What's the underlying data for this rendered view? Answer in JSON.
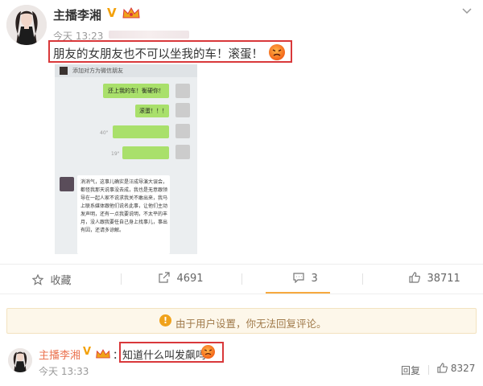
{
  "post": {
    "username": "主播李湘",
    "v_badge": "V",
    "time": "今天 13:23",
    "text": "朋友的女朋友也不可以坐我的车！滚蛋！",
    "emoji_icon": "angry-face-emoji"
  },
  "chat_screenshot": {
    "header": "添加对方为微信朋友",
    "messages": [
      {
        "side": "right",
        "text": "还上我的车！衡硬你！"
      },
      {
        "side": "right",
        "text": "滚蛋！！！"
      },
      {
        "side": "right",
        "text": ""
      },
      {
        "side": "right",
        "text": ""
      }
    ],
    "timestamps": [
      "40\"",
      "19\""
    ],
    "long_message": "消消气，这事儿确实是汪成导演大误会，都怪我那天说事没去成，我也是无意跟领导在一起人家不说求我关不敢出来，我马上联系媒体跟他们说名此事，让他们主动发声明，还有一点我要说明，不太平的丰月，没人跟我要任自己身上找事儿，事出有因，还请多谅解。"
  },
  "actions": {
    "favorite": "收藏",
    "repost": "4691",
    "comment": "3",
    "like": "38711"
  },
  "notice": {
    "text": "由于用户设置，你无法回复评论。"
  },
  "comment": {
    "username": "主播李湘",
    "v_badge": "V",
    "colon": "：",
    "text": "知道什么叫发飙吗",
    "time": "今天 13:33",
    "reply": "回复",
    "likes": "8327"
  },
  "colors": {
    "accent": "#eb7350",
    "highlight_border": "#d9383a",
    "verified": "#f3a10a",
    "notice_bg": "#fdf7ea"
  }
}
